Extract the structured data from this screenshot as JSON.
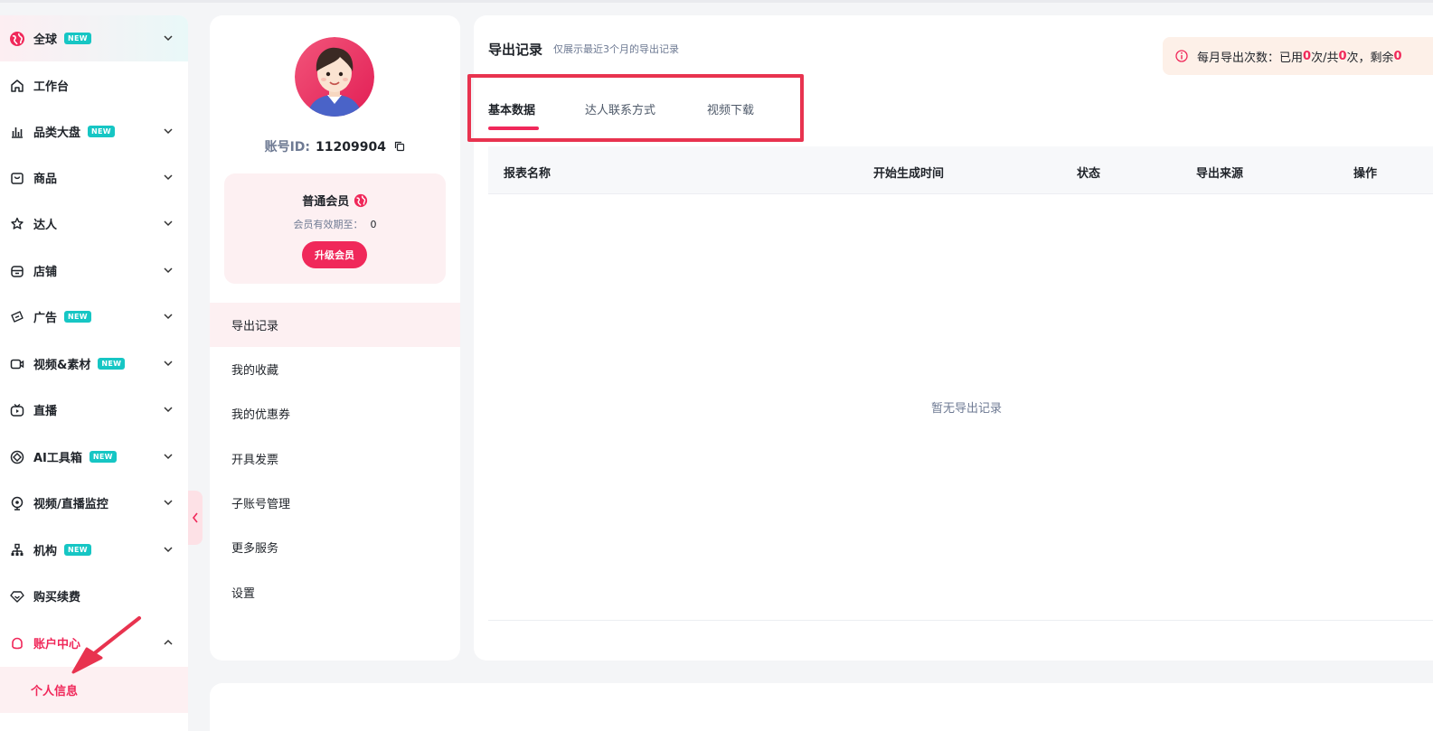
{
  "sidebar": {
    "items": [
      {
        "label": "全球",
        "badge": "NEW",
        "icon": "globe-icon",
        "chevron": "down"
      },
      {
        "label": "工作台",
        "icon": "home-icon"
      },
      {
        "label": "品类大盘",
        "badge": "NEW",
        "icon": "bar-chart-icon",
        "chevron": "down"
      },
      {
        "label": "商品",
        "icon": "shopping-bag-icon",
        "chevron": "down"
      },
      {
        "label": "达人",
        "icon": "star-person-icon",
        "chevron": "down"
      },
      {
        "label": "店铺",
        "icon": "store-icon",
        "chevron": "down"
      },
      {
        "label": "广告",
        "badge": "NEW",
        "icon": "ad-icon",
        "chevron": "down"
      },
      {
        "label": "视频&素材",
        "badge": "NEW",
        "icon": "video-icon",
        "chevron": "down"
      },
      {
        "label": "直播",
        "icon": "live-icon",
        "chevron": "down"
      },
      {
        "label": "AI工具箱",
        "badge": "NEW",
        "icon": "ai-toolbox-icon",
        "chevron": "down"
      },
      {
        "label": "视频/直播监控",
        "icon": "monitor-icon",
        "chevron": "down"
      },
      {
        "label": "机构",
        "badge": "NEW",
        "icon": "organization-icon",
        "chevron": "down"
      },
      {
        "label": "购买续费",
        "icon": "diamond-icon"
      },
      {
        "label": "账户中心",
        "icon": "account-icon",
        "chevron": "up"
      }
    ],
    "sub_item": "个人信息"
  },
  "profile": {
    "account_label": "账号ID:",
    "account_id": "11209904",
    "member_level": "普通会员",
    "expire_label": "会员有效期至：",
    "expire_value": "0",
    "upgrade_label": "升级会员",
    "menu": [
      "导出记录",
      "我的收藏",
      "我的优惠券",
      "开具发票",
      "子账号管理",
      "更多服务",
      "设置"
    ]
  },
  "main": {
    "title": "导出记录",
    "subtitle": "仅展示最近3个月的导出记录",
    "quota_prefix": "每月导出次数：已用",
    "quota_used": "0",
    "quota_mid": "次/共",
    "quota_total": "0",
    "quota_suffix": "次，剩余",
    "quota_left": "0",
    "tabs": [
      "基本数据",
      "达人联系方式",
      "视频下载"
    ],
    "columns": [
      "报表名称",
      "开始生成时间",
      "状态",
      "导出来源",
      "操作"
    ],
    "empty_text": "暂无导出记录"
  },
  "colors": {
    "accent": "#f0285a",
    "badge": "#16c6c4",
    "annotation": "#e8334f"
  }
}
